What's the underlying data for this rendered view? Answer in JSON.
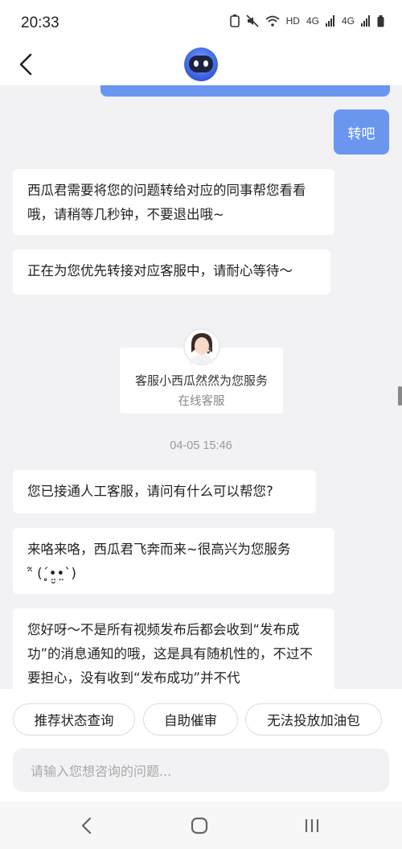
{
  "status_bar": {
    "time": "20:33",
    "hd": "HD",
    "signal1": "4G",
    "signal2": "4G"
  },
  "icons": {
    "back": "chevron-left-icon",
    "bot": "robot-avatar-icon",
    "agent": "agent-avatar-icon"
  },
  "colors": {
    "accent": "#6a96ef",
    "background": "#f2f2f4"
  },
  "messages": {
    "user_1": "转吧",
    "bot_1": "西瓜君需要将您的问题转给对应的同事帮您看看哦，请稍等几秒钟，不要退出哦~",
    "bot_2": "正在为您优先转接对应客服中，请耐心等待～"
  },
  "agent_card": {
    "name": "客服小西瓜然然为您服务",
    "role": "在线客服"
  },
  "timestamp": "04-05 15:46",
  "agent_messages": {
    "m1": "您已接通人工客服，请问有什么可以帮您?",
    "m2_line1": "来咯来咯，西瓜君飞奔而来~很高兴为您服务",
    "m2_line2": "ᵔ̃ (ˊ̥•̤̮•̤ˋ)",
    "m3": "您好呀～不是所有视频发布后都会收到“发布成功”的消息通知的哦，这是具有随机性的，不过不要担心，没有收到“发布成功”并不代"
  },
  "quick_replies": [
    "推荐状态查询",
    "自助催审",
    "无法投放加油包"
  ],
  "input": {
    "placeholder": "请输入您想咨询的问题..."
  }
}
